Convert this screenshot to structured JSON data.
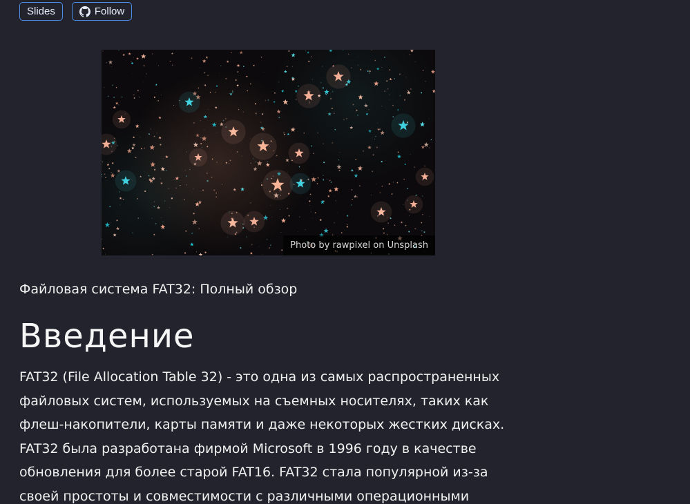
{
  "buttons": {
    "slides_label": "Slides",
    "follow_label": "Follow",
    "follow_icon": "github-icon"
  },
  "hero": {
    "credit": "Photo by rawpixel on Unsplash"
  },
  "article": {
    "subtitle": "Файловая система FAT32: Полный обзор",
    "heading": "Введение",
    "paragraph": "FAT32 (File Allocation Table 32) - это одна из самых распространенных файловых систем, используемых на съемных носителях, таких как флеш-накопители, карты памяти и даже некоторых жестких дисках. FAT32 была разработана фирмой Microsoft в 1996 году в качестве обновления для более старой FAT16. FAT32 стала популярной из-за своей простоты и совместимости с различными операционными"
  },
  "colors": {
    "background": "#22232c",
    "button_border": "#4a8ee6",
    "text": "#f3f3f5"
  }
}
